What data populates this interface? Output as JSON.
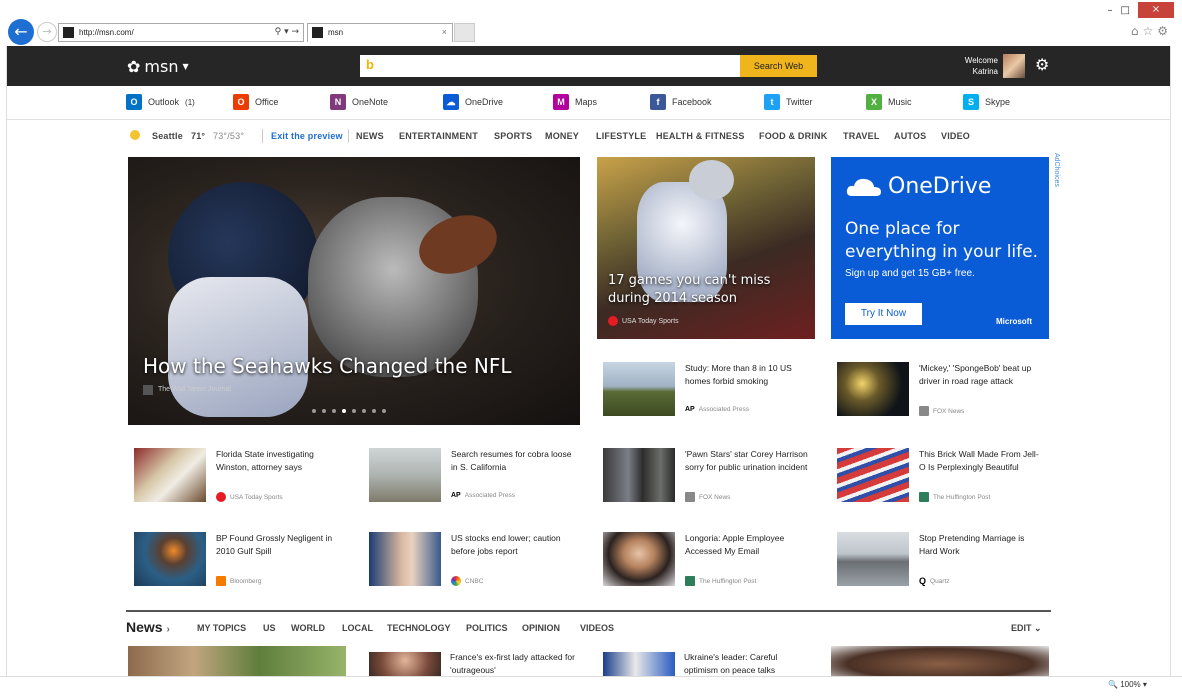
{
  "browser": {
    "url": "http://msn.com/",
    "tab_title": "msn"
  },
  "header": {
    "logo": "msn",
    "search_button": "Search Web",
    "welcome_line1": "Welcome",
    "welcome_line2": "Katrina"
  },
  "apps": [
    {
      "label": "Outlook",
      "count": "(1)",
      "color": "#0072c6",
      "glyph": "O"
    },
    {
      "label": "Office",
      "color": "#eb3c00",
      "glyph": "O"
    },
    {
      "label": "OneNote",
      "color": "#80397b",
      "glyph": "N"
    },
    {
      "label": "OneDrive",
      "color": "#0a5bd6",
      "glyph": "☁"
    },
    {
      "label": "Maps",
      "color": "#b4009e",
      "glyph": "M"
    },
    {
      "label": "Facebook",
      "color": "#3b5998",
      "glyph": "f"
    },
    {
      "label": "Twitter",
      "color": "#1da1f2",
      "glyph": "t"
    },
    {
      "label": "Music",
      "color": "#52b043",
      "glyph": "X"
    },
    {
      "label": "Skype",
      "color": "#00aff0",
      "glyph": "S"
    }
  ],
  "weather": {
    "city": "Seattle",
    "temp": "71°",
    "range": "73°/53°"
  },
  "nav": {
    "exit_preview": "Exit the preview",
    "items": [
      "NEWS",
      "ENTERTAINMENT",
      "SPORTS",
      "MONEY",
      "LIFESTYLE",
      "HEALTH & FITNESS",
      "FOOD & DRINK",
      "TRAVEL",
      "AUTOS",
      "VIDEO"
    ]
  },
  "hero": {
    "title": "How the Seahawks Changed the NFL",
    "source": "The Wall Street Journal"
  },
  "tile2": {
    "title": "17 games you can't miss during 2014 season",
    "source": "USA Today Sports"
  },
  "ad": {
    "brand": "OneDrive",
    "tagline": "One place for everything in your life.",
    "sub": "Sign up and get 15 GB+ free.",
    "cta": "Try It Now",
    "sponsor": "Microsoft",
    "adchoices": "AdChoices"
  },
  "stories": {
    "r1a": {
      "headline": "Study: More than 8 in 10 US homes forbid smoking",
      "source": "Associated Press"
    },
    "r1b": {
      "headline": "'Mickey,' 'SpongeBob' beat up driver in road rage attack",
      "source": "FOX News"
    },
    "r2a": {
      "headline": "Florida State investigating Winston, attorney says",
      "source": "USA Today Sports"
    },
    "r2b": {
      "headline": "Search resumes for cobra loose in S. California",
      "source": "Associated Press"
    },
    "r2c": {
      "headline": "'Pawn Stars' star Corey Harrison sorry for public urination incident",
      "source": "FOX News"
    },
    "r2d": {
      "headline": "This Brick Wall Made From Jell-O Is Perplexingly Beautiful",
      "source": "The Huffington Post"
    },
    "r3a": {
      "headline": "BP Found Grossly Negligent in 2010 Gulf Spill",
      "source": "Bloomberg"
    },
    "r3b": {
      "headline": "US stocks end lower; caution before jobs report",
      "source": "CNBC"
    },
    "r3c": {
      "headline": "Longoria: Apple Employee Accessed My Email",
      "source": "The Huffington Post"
    },
    "r3d": {
      "headline": "Stop Pretending Marriage is Hard Work",
      "source": "Quartz"
    },
    "r4b": {
      "headline": "France's ex-first lady attacked for 'outrageous'",
      "source": ""
    },
    "r4c": {
      "headline": "Ukraine's leader: Careful optimism on peace talks",
      "source": ""
    }
  },
  "news_section": {
    "title": "News",
    "tabs": [
      "MY TOPICS",
      "US",
      "WORLD",
      "LOCAL",
      "TECHNOLOGY",
      "POLITICS",
      "OPINION",
      "VIDEOS"
    ],
    "edit": "EDIT"
  },
  "status": {
    "zoom": "100%"
  }
}
